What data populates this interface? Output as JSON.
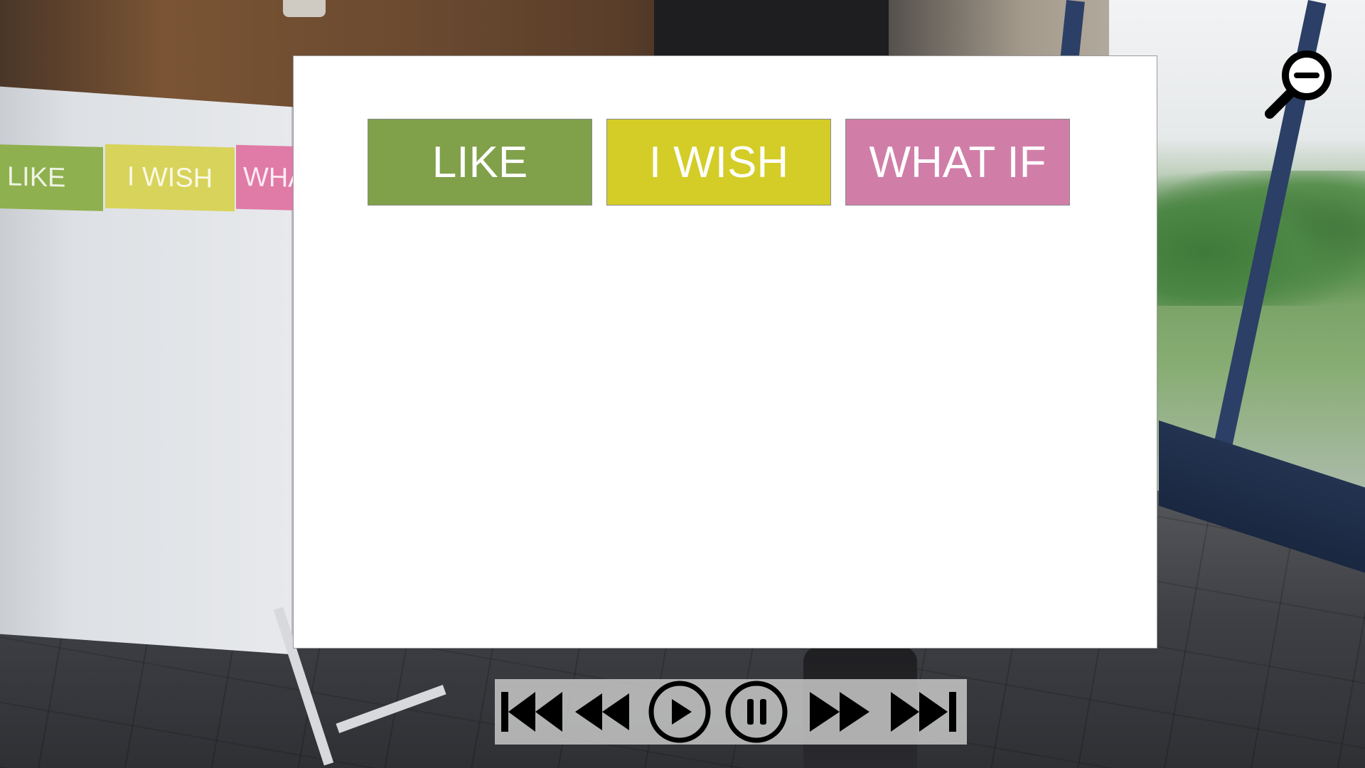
{
  "board_labels": {
    "like": "LIKE",
    "wish": "I WISH",
    "what_if": "WHA"
  },
  "panel": {
    "tags": [
      {
        "label": "LIKE",
        "color": "#80a04a"
      },
      {
        "label": "I WISH",
        "color": "#d4cd27"
      },
      {
        "label": "WHAT IF",
        "color": "#d07ea8"
      }
    ]
  },
  "zoom": {
    "icon": "zoom-out-icon"
  },
  "player_controls": [
    {
      "name": "skip-to-start-button",
      "icon": "skip-start-icon"
    },
    {
      "name": "rewind-button",
      "icon": "rewind-icon"
    },
    {
      "name": "play-button",
      "icon": "play-icon"
    },
    {
      "name": "pause-button",
      "icon": "pause-icon"
    },
    {
      "name": "fast-forward-button",
      "icon": "fast-forward-icon"
    },
    {
      "name": "skip-to-end-button",
      "icon": "skip-end-icon"
    }
  ],
  "colors": {
    "like": "#80a04a",
    "wish": "#d4cd27",
    "what_if": "#d07ea8",
    "controls_bg": "#c8c8c8"
  }
}
